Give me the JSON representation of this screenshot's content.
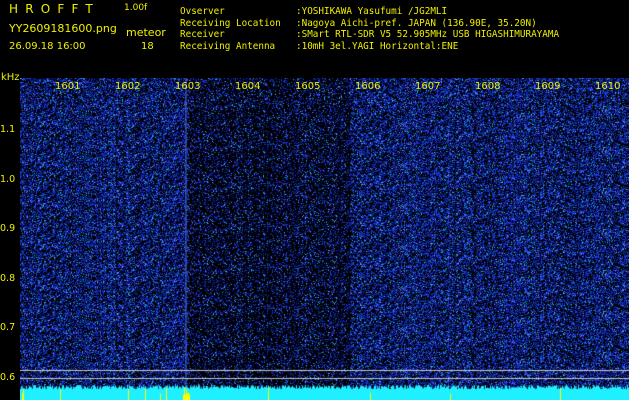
{
  "header": {
    "app_title": "HROFFT",
    "version": "1.00f",
    "filename": "YY2609181600.png",
    "timestamp": "26.09.18 16:00",
    "mode_label": "meteor",
    "mode_count": "18"
  },
  "info": [
    {
      "label": "Ovserver",
      "value": ":YOSHIKAWA Yasufumi /JG2MLI"
    },
    {
      "label": "Receiving Location",
      "value": ":Nagoya Aichi-pref. JAPAN (136.90E, 35.20N)"
    },
    {
      "label": "Receiver",
      "value": ":SMart RTL-SDR V5 52.905MHz USB HIGASHIMURAYAMA"
    },
    {
      "label": "Receiving Antenna",
      "value": ":10mH 3el.YAGI Horizontal:ENE"
    }
  ],
  "axis": {
    "y_unit": "kHz",
    "y_ticks": [
      "1.1",
      "1.0",
      "0.9",
      "0.8",
      "0.7",
      "0.6"
    ],
    "x_ticks": [
      "1601",
      "1602",
      "1603",
      "1604",
      "1605",
      "1606",
      "1607",
      "1608",
      "1609",
      "1610"
    ]
  },
  "colors": {
    "label": "#f0f000",
    "background": "#000000",
    "noise": "#1a3cff",
    "noise_dim": "#0a1a9a",
    "noise_bright": "#6b8bff",
    "trace": "#00ffff",
    "cyan_band": "#1ef0ff",
    "yellow_spike": "#ffff00",
    "grid_line": "#c8c8c8"
  }
}
